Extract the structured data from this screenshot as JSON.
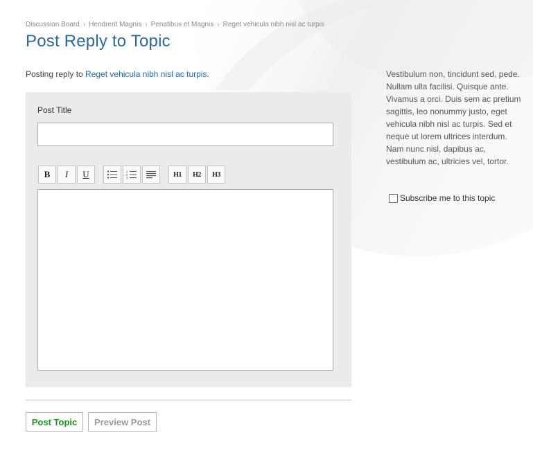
{
  "breadcrumb": {
    "items": [
      {
        "label": "Discussion Board"
      },
      {
        "label": "Hendrerit Magnis"
      },
      {
        "label": "Penatibus et Magnis"
      },
      {
        "label": "Reget vehicula nibh nisl ac turpis"
      }
    ],
    "separator": "›"
  },
  "page": {
    "title": "Post Reply to Topic"
  },
  "intro": {
    "prefix": "Posting reply to ",
    "topic_link": "Reget vehicula nibh nisl ac turpis",
    "suffix": "."
  },
  "form": {
    "post_title_label": "Post Title",
    "post_title_value": "",
    "body_value": "",
    "toolbar": {
      "bold": "B",
      "italic": "I",
      "underline": "U",
      "unordered_list_icon": "bullet-list-icon",
      "ordered_list_icon": "numbered-list-icon",
      "align_icon": "align-left-icon",
      "h1": "H1",
      "h2": "H2",
      "h3": "H3"
    }
  },
  "actions": {
    "post_topic": "Post Topic",
    "preview_post": "Preview Post"
  },
  "sidebar": {
    "text": "Vestibulum non, tincidunt sed, pede. Nullam ulla facilisi. Quisque ante. Vivamus a orci. Duis sem ac pretium sagittis, leo nonummy justo, eget vehicula nibh nisl ac turpis. Sed et neque ut lorem ultrices interdum. Nam nunc nisl, dapibus ac, vestibulum ac, ultricies vel, tortor.",
    "subscribe_label": "Subscribe me to this topic",
    "subscribe_checked": false
  },
  "colors": {
    "title": "#2a6a9e",
    "link": "#1f6aa8",
    "post_button": "#1a9a1a",
    "panel_bg": "#ebebeb"
  }
}
